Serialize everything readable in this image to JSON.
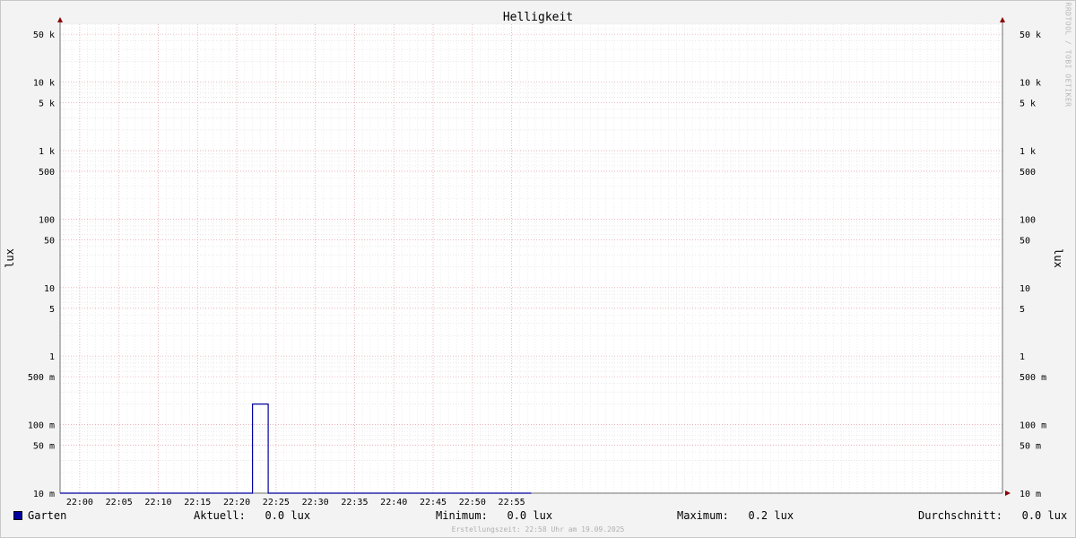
{
  "chart_data": {
    "type": "line",
    "title": "Helligkeit",
    "ylabel": "lux",
    "watermark": "RRDTOOL / TOBI OETIKER",
    "yscale": "log",
    "ylim": [
      0.01,
      70000
    ],
    "xlim": [
      "21:57:30",
      "23:57:30"
    ],
    "x_tick_labels": [
      "22:00",
      "22:05",
      "22:10",
      "22:15",
      "22:20",
      "22:25",
      "22:30",
      "22:35",
      "22:40",
      "22:45",
      "22:50",
      "22:55"
    ],
    "y_tick_labels": [
      "50 k",
      "10 k",
      "5 k",
      "1 k",
      "500",
      "100",
      "50",
      "10",
      "5",
      "1",
      "500 m",
      "100 m",
      "50 m",
      "10 m"
    ],
    "y_ticks": [
      50000,
      10000,
      5000,
      1000,
      500,
      100,
      50,
      10,
      5,
      1,
      0.5,
      0.1,
      0.05,
      0.01
    ],
    "grid": true,
    "legend_position": "bottom",
    "series": [
      {
        "name": "Garten",
        "color": "#0000a0",
        "points": [
          [
            "21:57:30",
            0.0
          ],
          [
            "22:22:00",
            0.0
          ],
          [
            "22:22:00",
            0.2
          ],
          [
            "22:24:00",
            0.2
          ],
          [
            "22:24:00",
            0.0
          ],
          [
            "22:57:30",
            0.0
          ]
        ]
      }
    ]
  },
  "legend": {
    "series_name": "Garten",
    "swatch_color": "#0000a0",
    "current": "Aktuell:   0.0 lux",
    "minimum": "Minimum:   0.0 lux",
    "maximum": "Maximum:   0.2 lux",
    "average": "Durchschnitt:   0.0 lux"
  },
  "footer": "Erstellungszeit: 22:58 Uhr am 19.09.2025"
}
